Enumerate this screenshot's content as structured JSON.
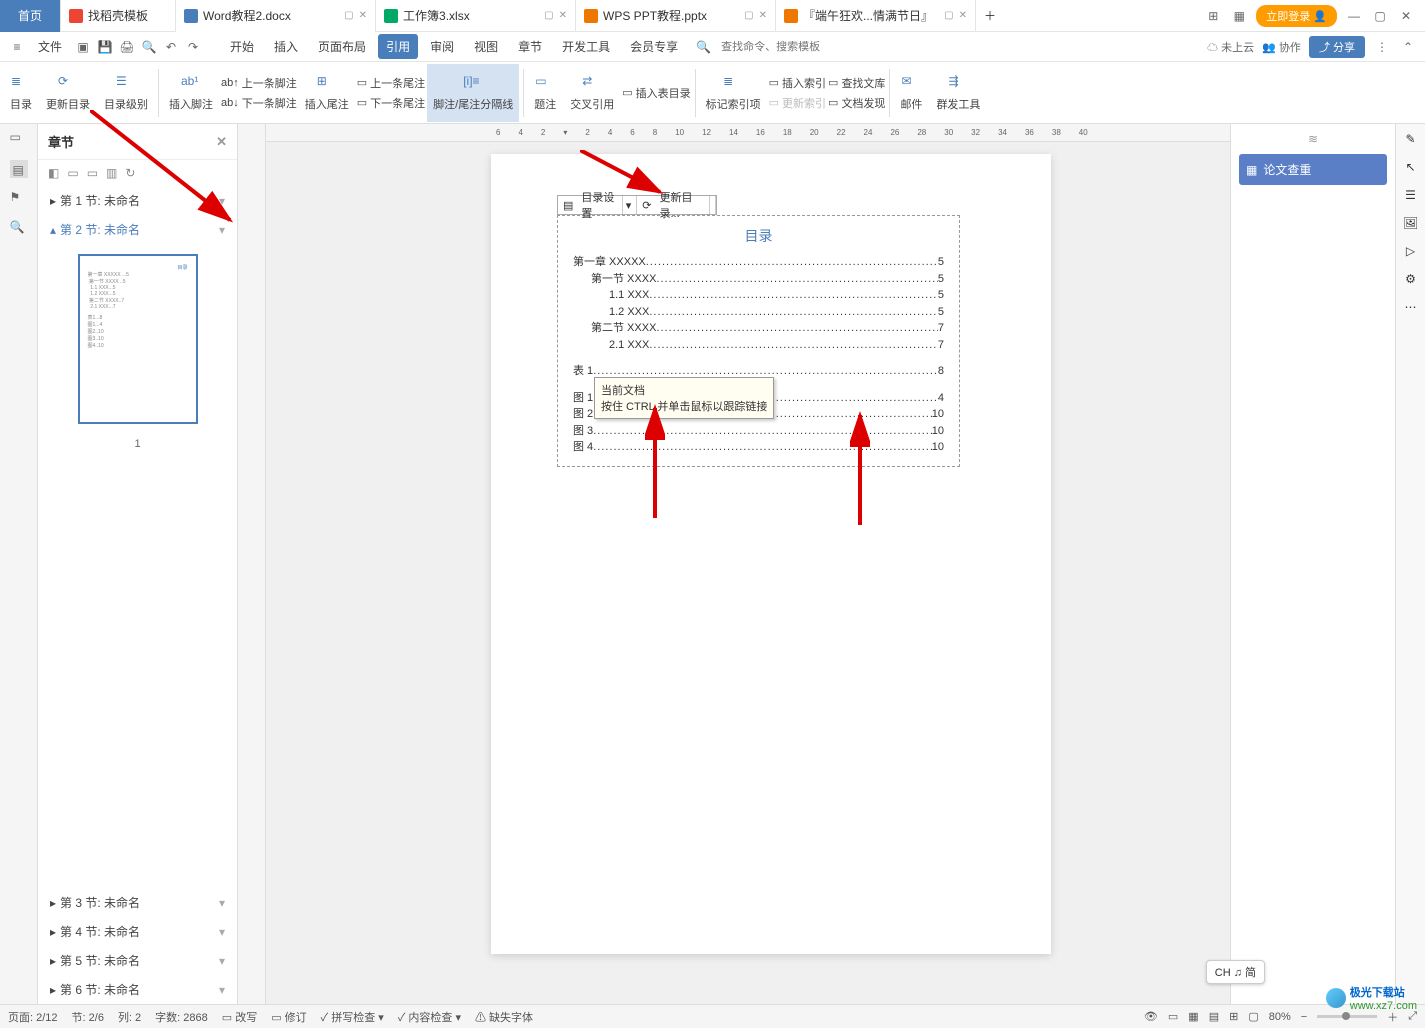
{
  "tabs": {
    "home": "首页",
    "t1": "找稻壳模板",
    "t2": "Word教程2.docx",
    "t3": "工作簿3.xlsx",
    "t4": "WPS PPT教程.pptx",
    "t5": "『端午狂欢...情满节日』"
  },
  "titlectrl": {
    "login": "立即登录"
  },
  "menubar": {
    "file": "文件",
    "items": [
      "开始",
      "插入",
      "页面布局",
      "引用",
      "审阅",
      "视图",
      "章节",
      "开发工具",
      "会员专享"
    ],
    "active": "引用",
    "search_ph": "查找命令、搜索模板",
    "cloud": "未上云",
    "coop": "协作",
    "share": "分享"
  },
  "ribbon": {
    "toc": "目录",
    "update_toc": "更新目录",
    "toc_level": "目录级别",
    "insert_fn": "插入脚注",
    "prev_fn": "上一条脚注",
    "next_fn": "下一条脚注",
    "insert_en": "插入尾注",
    "prev_en": "上一条尾注",
    "next_en": "下一条尾注",
    "fn_sep": "脚注/尾注分隔线",
    "caption": "题注",
    "cross_ref": "交叉引用",
    "mark_idx": "标记索引项",
    "insert_toc2": "插入表目录",
    "insert_idx": "插入索引",
    "find_lib": "查找文库",
    "update_idx": "更新索引",
    "doc_find": "文档发现",
    "mail": "邮件",
    "group_tool": "群发工具"
  },
  "nav": {
    "title": "章节",
    "s1": "第 1 节: 未命名",
    "s2": "第 2 节: 未命名",
    "s3": "第 3 节: 未命名",
    "s4": "第 4 节: 未命名",
    "s5": "第 5 节: 未命名",
    "s6": "第 6 节: 未命名",
    "thumb_num": "1"
  },
  "toc_controls": {
    "settings": "目录设置",
    "update": "更新目录..."
  },
  "toc": {
    "title": "目录",
    "lines": [
      {
        "t": "第一章  XXXXX",
        "p": "5",
        "i": 0
      },
      {
        "t": "第一节  XXXX",
        "p": "5",
        "i": 1
      },
      {
        "t": "1.1 XXX",
        "p": "5",
        "i": 2
      },
      {
        "t": "1.2 XXX",
        "p": "5",
        "i": 2
      },
      {
        "t": "第二节  XXXX",
        "p": "7",
        "i": 1
      },
      {
        "t": "2.1 XXX",
        "p": "7",
        "i": 2
      }
    ],
    "table": {
      "t": "表  1",
      "p": "8"
    },
    "figs": [
      {
        "t": "图  1",
        "p": "4"
      },
      {
        "t": "图  2",
        "p": "10"
      },
      {
        "t": "图  3",
        "p": "10"
      },
      {
        "t": "图  4",
        "p": "10"
      }
    ]
  },
  "tooltip": {
    "l1": "当前文档",
    "l2": "按住 CTRL 并单击鼠标以跟踪链接"
  },
  "rightpanel": {
    "paper_check": "论文查重"
  },
  "ruler": [
    "6",
    "4",
    "2",
    "",
    "2",
    "4",
    "6",
    "8",
    "10",
    "12",
    "14",
    "16",
    "18",
    "20",
    "22",
    "24",
    "26",
    "28",
    "30",
    "32",
    "34",
    "36",
    "38",
    "40"
  ],
  "status": {
    "page": "页面: 2/12",
    "section": "节: 2/6",
    "col": "列: 2",
    "words": "字数: 2868",
    "rewrite": "改写",
    "revise": "修订",
    "spell": "拼写检查",
    "content": "内容检查",
    "font": "缺失字体",
    "zoom": "80%"
  },
  "ime": "CH ♫ 简",
  "watermark": {
    "name": "极光下载站",
    "url": "www.xz7.com"
  }
}
